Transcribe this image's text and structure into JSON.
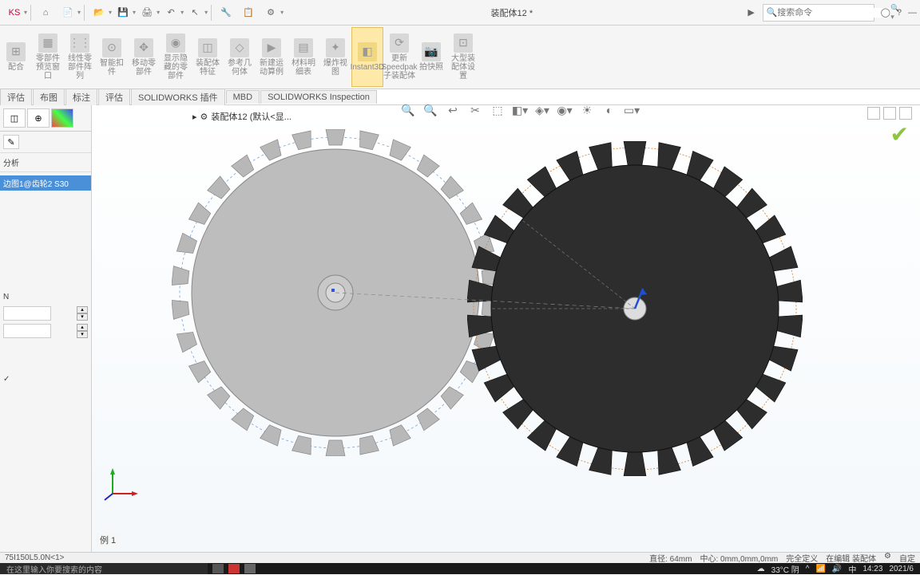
{
  "title": "装配体12 *",
  "search_placeholder": "搜索命令",
  "ribbon": {
    "buttons": [
      {
        "label": "配合"
      },
      {
        "label": "零部件预览窗口"
      },
      {
        "label": "线性零部件阵列"
      },
      {
        "label": "智能扣件"
      },
      {
        "label": "移动零部件"
      },
      {
        "label": "显示隐藏的零部件"
      },
      {
        "label": "装配体特征"
      },
      {
        "label": "参考几何体"
      },
      {
        "label": "新建运动算例"
      },
      {
        "label": "材料明细表"
      },
      {
        "label": "爆炸视图"
      },
      {
        "label": "Instant3D"
      },
      {
        "label": "更新Speedpak子装配体"
      },
      {
        "label": "拍快照"
      },
      {
        "label": "大型装配体设置"
      }
    ],
    "active_index": 11
  },
  "tabs": [
    "评估",
    "布图",
    "标注",
    "评估",
    "SOLIDWORKS 插件",
    "MBD",
    "SOLIDWORKS Inspection"
  ],
  "tree": {
    "root": "装配体12 (默认<显..."
  },
  "panel": {
    "sub_tab": "分析",
    "selected_item": "边图1@齿轮2  S30",
    "letter": "N"
  },
  "status": {
    "left": "75I150L5.0N<1>",
    "instance": "例 1",
    "length": "直径: 64mm",
    "center": "中心: 0mm,0mm,0mm",
    "def": "完全定义",
    "mode": "在编辑 装配体"
  },
  "taskbar": {
    "search": "在这里输入你要搜索的内容",
    "weather": "33°C 阴",
    "time": "14:23",
    "date": "2021/6"
  }
}
